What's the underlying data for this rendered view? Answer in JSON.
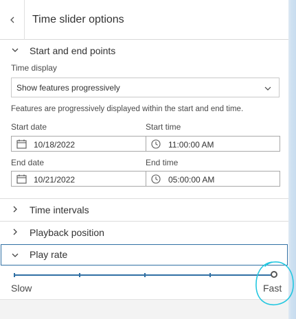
{
  "header": {
    "title": "Time slider options",
    "back_icon": "chevron-left-icon"
  },
  "start_end": {
    "title": "Start and end points",
    "time_display_label": "Time display",
    "time_display_value": "Show features progressively",
    "description": "Features are progressively displayed within the start and end time.",
    "start_date_label": "Start date",
    "start_date_value": "10/18/2022",
    "start_time_label": "Start time",
    "start_time_value": "11:00:00 AM",
    "end_date_label": "End date",
    "end_date_value": "10/21/2022",
    "end_time_label": "End time",
    "end_time_value": "05:00:00 AM"
  },
  "sections": {
    "time_intervals": "Time intervals",
    "playback_position": "Playback position"
  },
  "play_rate": {
    "title": "Play rate",
    "slow_label": "Slow",
    "fast_label": "Fast",
    "value_fraction": 1.0,
    "tick_count": 5
  },
  "colors": {
    "accent": "#2f6fa3",
    "annotation": "#22c7e0"
  }
}
